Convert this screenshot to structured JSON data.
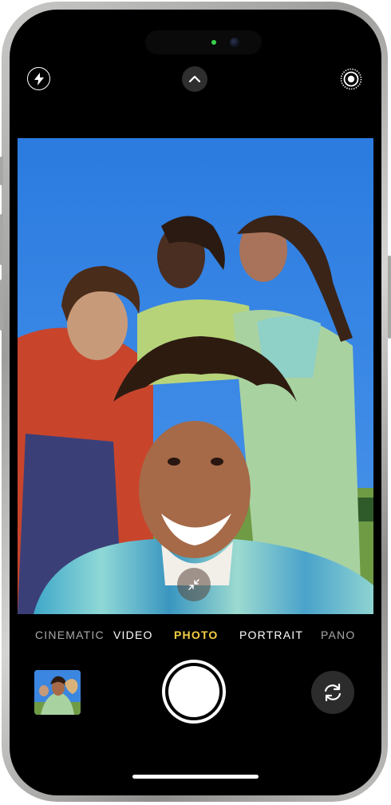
{
  "camera": {
    "modes": [
      {
        "label": "CINEMATIC",
        "state": "inactive"
      },
      {
        "label": "VIDEO",
        "state": "inactive"
      },
      {
        "label": "PHOTO",
        "state": "selected"
      },
      {
        "label": "PORTRAIT",
        "state": "inactive"
      },
      {
        "label": "PANO",
        "state": "inactive"
      }
    ],
    "selected_mode": "PHOTO",
    "accent_color": "#f6cf45",
    "privacy_indicator_color": "#37d34a",
    "top_controls": [
      {
        "name": "flash",
        "icon": "lightning-bolt-icon"
      },
      {
        "name": "show-settings",
        "icon": "chevron-up-icon"
      },
      {
        "name": "live-photo",
        "icon": "live-photo-icon"
      }
    ],
    "bottom_controls": [
      {
        "name": "last-photo-thumbnail",
        "icon": "photo-thumbnail"
      },
      {
        "name": "shutter",
        "icon": "shutter-button"
      },
      {
        "name": "switch-camera",
        "icon": "rotate-camera-icon"
      }
    ],
    "viewfinder_control": {
      "name": "zoom-toggle",
      "icon": "collapse-arrows-icon"
    }
  }
}
